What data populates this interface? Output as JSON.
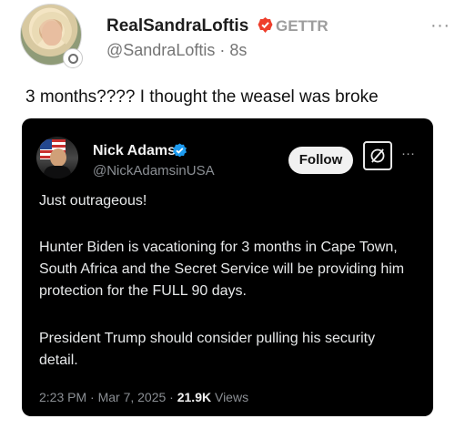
{
  "post": {
    "author": {
      "display_name": "RealSandraLoftis",
      "handle_line": "@SandraLoftis · 8s",
      "platform": "GETTR"
    },
    "text": "3 months???? I thought the weasel was broke"
  },
  "embedded_post": {
    "author": {
      "display_name": "Nick Adams",
      "handle": "@NickAdamsinUSA"
    },
    "follow_label": "Follow",
    "paragraphs": [
      "Just outrageous!",
      "Hunter Biden is vacationing for 3 months in Cape Town, South Africa and the Secret Service will be providing him protection for the FULL 90 days.",
      "President Trump should consider pulling his security detail."
    ],
    "meta": {
      "timestamp": "2:23 PM · Mar 7, 2025 · ",
      "views_count": "21.9K",
      "views_label": " Views"
    }
  },
  "icons": [
    "more-icon",
    "verified-badge-icon",
    "grok-icon",
    "embedded-more-icon"
  ],
  "colors": {
    "badge_red": "#ee3e2b",
    "verified_blue": "#1d9bf0",
    "embed_background": "#000000",
    "follow_background": "#f1f1f1"
  }
}
